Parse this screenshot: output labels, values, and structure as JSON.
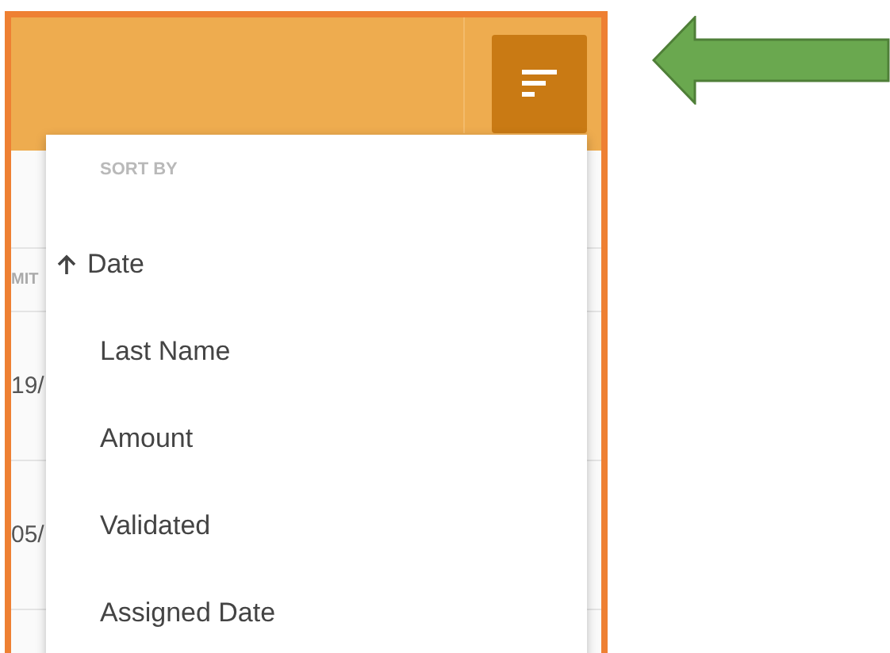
{
  "table": {
    "header": "MIT",
    "rows": [
      "19/",
      "05/"
    ]
  },
  "sort_menu": {
    "heading": "SORT BY",
    "items": [
      {
        "label": "Date",
        "selected": true
      },
      {
        "label": "Last Name",
        "selected": false
      },
      {
        "label": "Amount",
        "selected": false
      },
      {
        "label": "Validated",
        "selected": false
      },
      {
        "label": "Assigned Date",
        "selected": false
      }
    ]
  }
}
